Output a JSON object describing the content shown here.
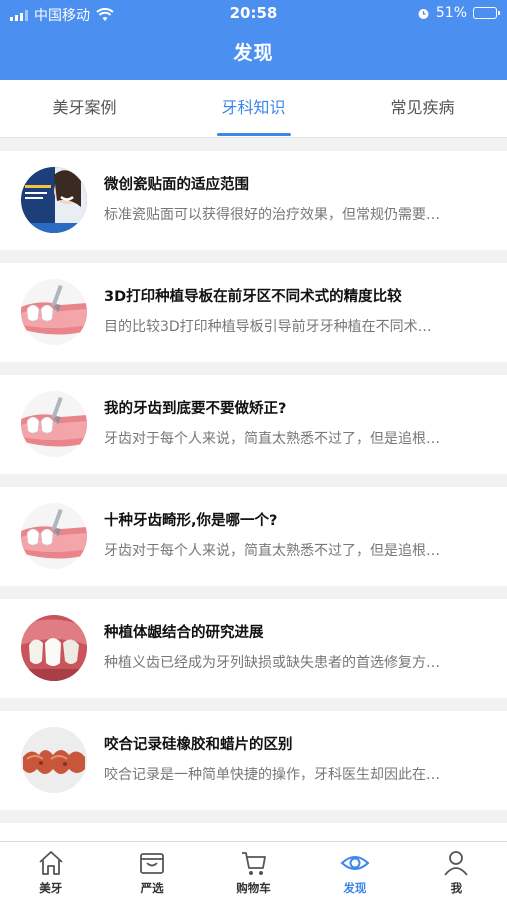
{
  "status_bar": {
    "carrier": "中国移动",
    "time": "20:58",
    "battery": "51%",
    "battery_level": 0.51
  },
  "header": {
    "title": "发现"
  },
  "tabs": [
    {
      "label": "美牙案例",
      "active": false
    },
    {
      "label": "牙科知识",
      "active": true
    },
    {
      "label": "常见疾病",
      "active": false
    }
  ],
  "articles": [
    {
      "title": "微创瓷贴面的适应范围",
      "summary": "标准瓷贴面可以获得很好的治疗效果，但常规仍需要…",
      "thumbnail": "smile-ad-image"
    },
    {
      "title": "3D打印种植导板在前牙区不同术式的精度比较",
      "summary": "目的比较3D打印种植导板引导前牙牙种植在不同术…",
      "thumbnail": "implant-illustration"
    },
    {
      "title": "我的牙齿到底要不要做矫正?",
      "summary": "牙齿对于每个人来说，简直太熟悉不过了，但是追根…",
      "thumbnail": "implant-illustration"
    },
    {
      "title": "十种牙齿畸形,你是哪一个?",
      "summary": "牙齿对于每个人来说，简直太熟悉不过了，但是追根…",
      "thumbnail": "implant-illustration"
    },
    {
      "title": "种植体龈结合的研究进展",
      "summary": "种植义齿已经成为牙列缺损或缺失患者的首选修复方…",
      "thumbnail": "teeth-gum-photo"
    },
    {
      "title": "咬合记录硅橡胶和蜡片的区别",
      "summary": "咬合记录是一种简单快捷的操作，牙科医生却因此在…",
      "thumbnail": "bite-wax-photo"
    }
  ],
  "tabbar": [
    {
      "label": "美牙",
      "icon": "home-icon",
      "active": false
    },
    {
      "label": "严选",
      "icon": "shop-icon",
      "active": false
    },
    {
      "label": "购物车",
      "icon": "cart-icon",
      "active": false
    },
    {
      "label": "发现",
      "icon": "eye-icon",
      "active": true
    },
    {
      "label": "我",
      "icon": "user-icon",
      "active": false
    }
  ],
  "colors": {
    "accent": "#4b8ff0",
    "active_tab": "#3d86ec",
    "background": "#f2f2f2"
  }
}
